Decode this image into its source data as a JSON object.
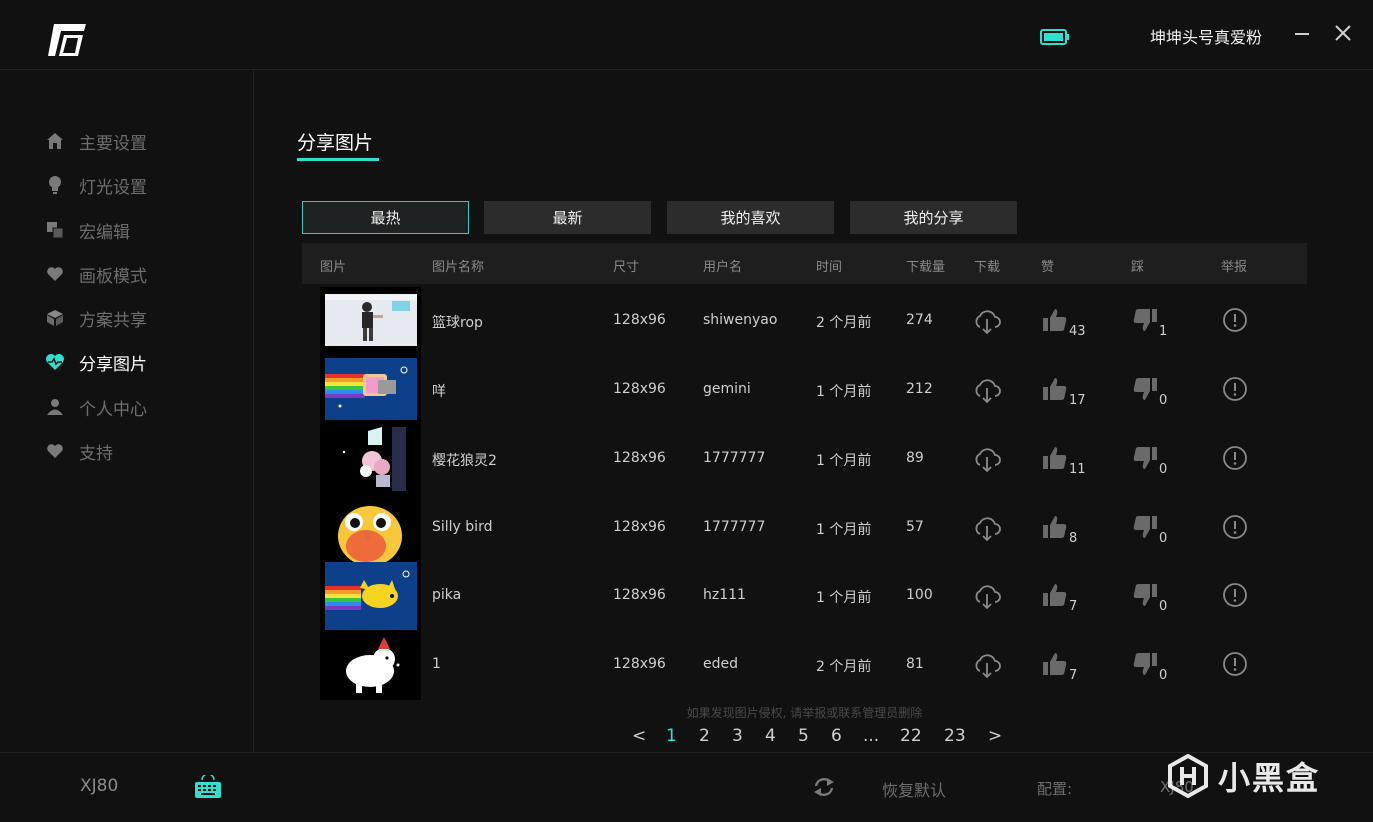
{
  "header": {
    "username": "坤坤头号真爱粉",
    "battery_color": "#2ee0d0"
  },
  "sidebar": {
    "items": [
      {
        "label": "主要设置",
        "icon": "home-icon"
      },
      {
        "label": "灯光设置",
        "icon": "lightbulb-icon"
      },
      {
        "label": "宏编辑",
        "icon": "macro-icon"
      },
      {
        "label": "画板模式",
        "icon": "heart-icon"
      },
      {
        "label": "方案共享",
        "icon": "cube-icon"
      },
      {
        "label": "分享图片",
        "icon": "heart-pulse-icon",
        "active": true
      },
      {
        "label": "个人中心",
        "icon": "user-icon"
      },
      {
        "label": "支持",
        "icon": "heart-icon"
      }
    ]
  },
  "main": {
    "title": "分享图片",
    "tabs": [
      {
        "label": "最热",
        "active": true
      },
      {
        "label": "最新"
      },
      {
        "label": "我的喜欢"
      },
      {
        "label": "我的分享"
      }
    ],
    "columns": [
      "图片",
      "图片名称",
      "尺寸",
      "用户名",
      "时间",
      "下载量",
      "下载",
      "赞",
      "踩",
      "举报"
    ],
    "rows": [
      {
        "name": "篮球rop",
        "size": "128x96",
        "user": "shiwenyao",
        "time": "2 个月前",
        "downloads": "274",
        "likes": "43",
        "dislikes": "1",
        "thumb": "basketball-photo"
      },
      {
        "name": "咩",
        "size": "128x96",
        "user": "gemini",
        "time": "1 个月前",
        "downloads": "212",
        "likes": "17",
        "dislikes": "0",
        "thumb": "nyan-cat"
      },
      {
        "name": "樱花狼灵2",
        "size": "128x96",
        "user": "1777777",
        "time": "1 个月前",
        "downloads": "89",
        "likes": "11",
        "dislikes": "0",
        "thumb": "sakura-pixel"
      },
      {
        "name": "Silly bird",
        "size": "128x96",
        "user": "1777777",
        "time": "1 个月前",
        "downloads": "57",
        "likes": "8",
        "dislikes": "0",
        "thumb": "parrot"
      },
      {
        "name": "pika",
        "size": "128x96",
        "user": "hz111",
        "time": "1 个月前",
        "downloads": "100",
        "likes": "7",
        "dislikes": "0",
        "thumb": "nyan-pikachu"
      },
      {
        "name": "1",
        "size": "128x96",
        "user": "eded",
        "time": "2 个月前",
        "downloads": "81",
        "likes": "7",
        "dislikes": "0",
        "thumb": "white-dog"
      }
    ],
    "notice": "如果发现图片侵权, 请举报或联系管理员删除",
    "pagination": {
      "prev": "<",
      "pages": [
        "1",
        "2",
        "3",
        "4",
        "5",
        "6",
        "...",
        "22",
        "23"
      ],
      "current": "1",
      "next": ">"
    }
  },
  "footer": {
    "device": "XJ80",
    "reset_label": "恢复默认",
    "config_label": "配置:",
    "config_value": "XJ80",
    "watermark": "小黑盒"
  },
  "colors": {
    "accent": "#2ee0d0",
    "background": "#111111",
    "muted_text": "#6e6e6e"
  }
}
